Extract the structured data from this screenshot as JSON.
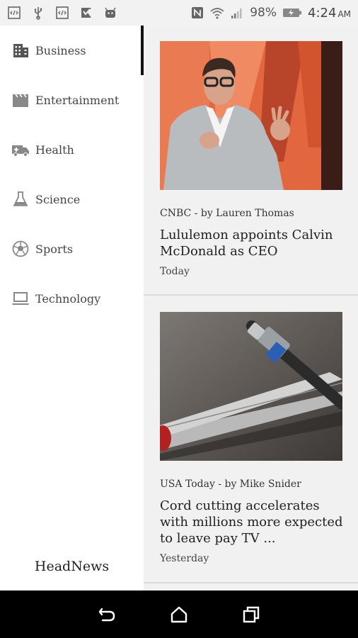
{
  "status_bar": {
    "battery": "98%",
    "time": "4:24",
    "ampm": "AM",
    "left_icons": [
      "code-icon",
      "usb-icon",
      "code-icon",
      "app-icon",
      "android-icon"
    ],
    "right_icons": [
      "nfc-icon",
      "wifi-icon",
      "signal-icon",
      "battery-icon"
    ]
  },
  "sidebar": {
    "items": [
      {
        "label": "Business",
        "icon": "business-building-icon",
        "selected": true
      },
      {
        "label": "Entertainment",
        "icon": "clapperboard-icon",
        "selected": false
      },
      {
        "label": "Health",
        "icon": "ambulance-icon",
        "selected": false
      },
      {
        "label": "Science",
        "icon": "flask-icon",
        "selected": false
      },
      {
        "label": "Sports",
        "icon": "soccer-ball-icon",
        "selected": false
      },
      {
        "label": "Technology",
        "icon": "laptop-icon",
        "selected": false
      }
    ],
    "brand": "HeadNews"
  },
  "feed": {
    "articles": [
      {
        "source": "CNBC - by Lauren Thomas",
        "title": "Lululemon appoints Calvin McDonald as CEO",
        "date": "Today"
      },
      {
        "source": "USA Today - by Mike Snider",
        "title": "Cord cutting accelerates with millions more expected to leave pay TV ...",
        "date": "Yesterday"
      }
    ]
  },
  "nav_bar": {
    "buttons": [
      "back-icon",
      "home-icon",
      "recents-icon"
    ]
  }
}
